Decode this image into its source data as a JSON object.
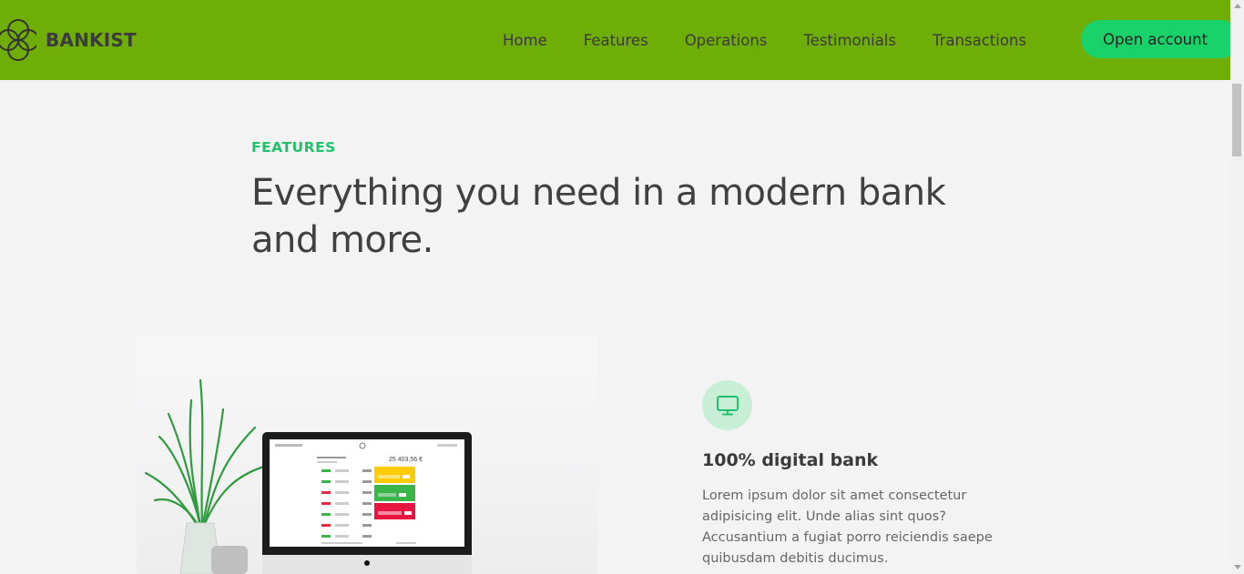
{
  "header": {
    "logo_text": "BANKIST",
    "nav": [
      "Home",
      "Features",
      "Operations",
      "Testimonials",
      "Transactions"
    ],
    "cta_label": "Open account",
    "bg_color": "#6fae06",
    "cta_color": "#1ad26a"
  },
  "section": {
    "tag": "FEATURES",
    "title": "Everything you need in a modern bank and more."
  },
  "feature": {
    "icon": "monitor-icon",
    "heading": "100% digital bank",
    "text": "Lorem ipsum dolor sit amet consectetur adipisicing elit. Unde alias sint quos? Accusantium a fugiat porro reiciendis saepe quibusdam debitis ducimus.",
    "screen_balance": "25 403,56 €"
  },
  "colors": {
    "accent": "#1fc26b",
    "icon_bg": "#c8efd6"
  }
}
